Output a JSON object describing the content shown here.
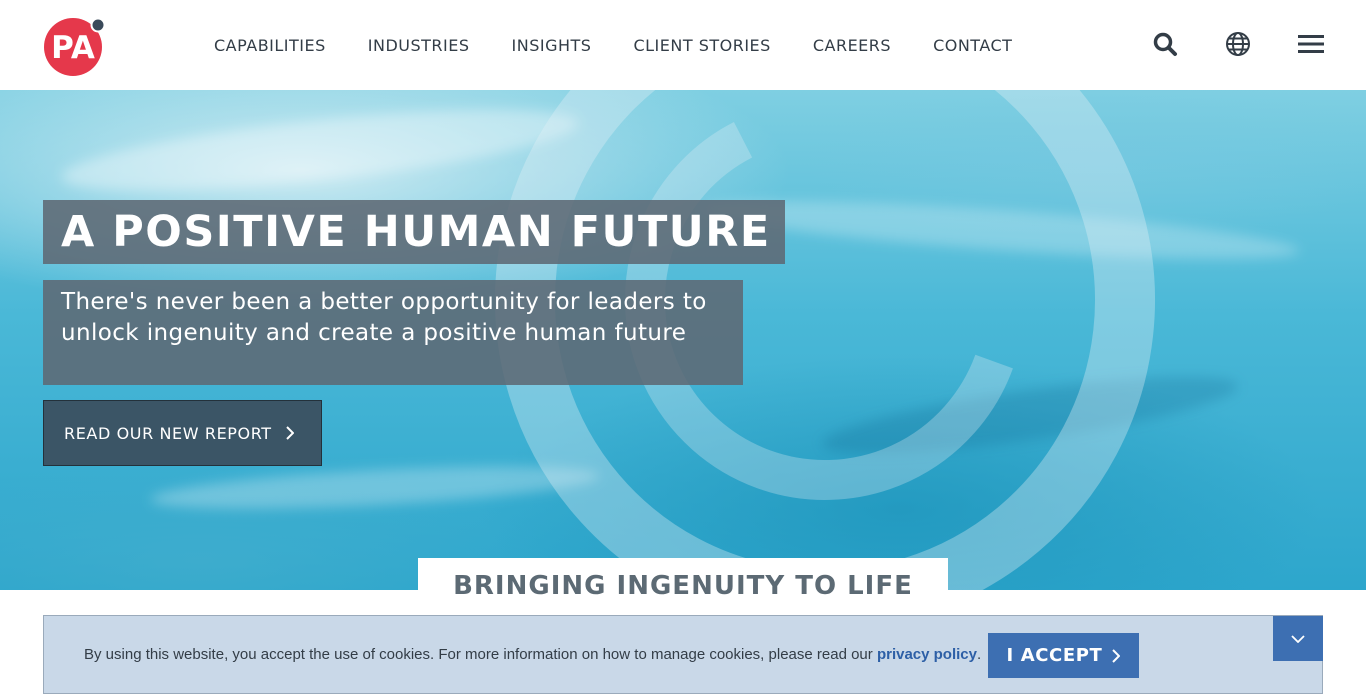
{
  "brand": {
    "logo_text": "PA",
    "accent": "#e5384b"
  },
  "nav": {
    "items": [
      {
        "label": "CAPABILITIES"
      },
      {
        "label": "INDUSTRIES"
      },
      {
        "label": "INSIGHTS"
      },
      {
        "label": "CLIENT STORIES"
      },
      {
        "label": "CAREERS"
      },
      {
        "label": "CONTACT"
      }
    ]
  },
  "header_icons": [
    "search-icon",
    "globe-icon",
    "menu-icon"
  ],
  "hero": {
    "title": "A POSITIVE HUMAN FUTURE",
    "subtitle": "There's never been a better opportunity for leaders to unlock ingenuity and create a positive human future",
    "cta_label": "READ OUR NEW REPORT"
  },
  "tagline": "BRINGING INGENUITY TO LIFE",
  "cookie": {
    "text": "By using this website, you accept the use of cookies. For more information on how to manage cookies, please read our ",
    "link_text": "privacy policy",
    "after_link": ".",
    "accept_label": "I ACCEPT"
  },
  "colors": {
    "cookie_bg": "#c9d8e8",
    "accept_bg": "#3d6fb2",
    "nav_text": "#333d47"
  }
}
